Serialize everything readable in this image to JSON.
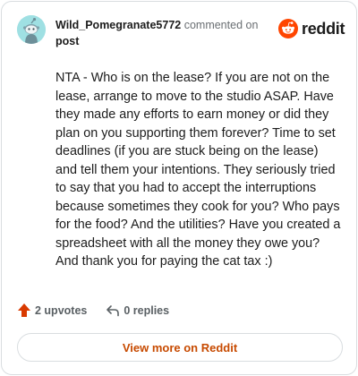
{
  "header": {
    "username": "Wild_Pomegranate5772",
    "action_text": " commented on",
    "target_text": "post"
  },
  "brand": {
    "wordmark": "reddit",
    "color": "#ff4500"
  },
  "comment": {
    "body": "NTA - Who is on the lease? If you are not on the lease, arrange to move to the studio ASAP. Have they made any efforts to earn money or did they plan on you supporting them forever? Time to set deadlines (if you are stuck being on the lease) and tell them your intentions. They seriously tried to say that you had to accept the interruptions because sometimes they cook for you? Who pays for the food? And the utilities? Have you created a spreadsheet with all the money they owe you? And thank you for paying the cat tax :)"
  },
  "actions": {
    "upvotes_label": "2 upvotes",
    "replies_label": "0 replies",
    "upvote_color": "#d93a00"
  },
  "footer": {
    "view_more_label": "View more on Reddit",
    "view_more_color": "#c74a00"
  },
  "icons": {
    "avatar": "snoo-avatar-icon",
    "logo": "reddit-logo-icon",
    "upvote": "upvote-arrow-icon",
    "reply": "reply-arrow-icon"
  }
}
